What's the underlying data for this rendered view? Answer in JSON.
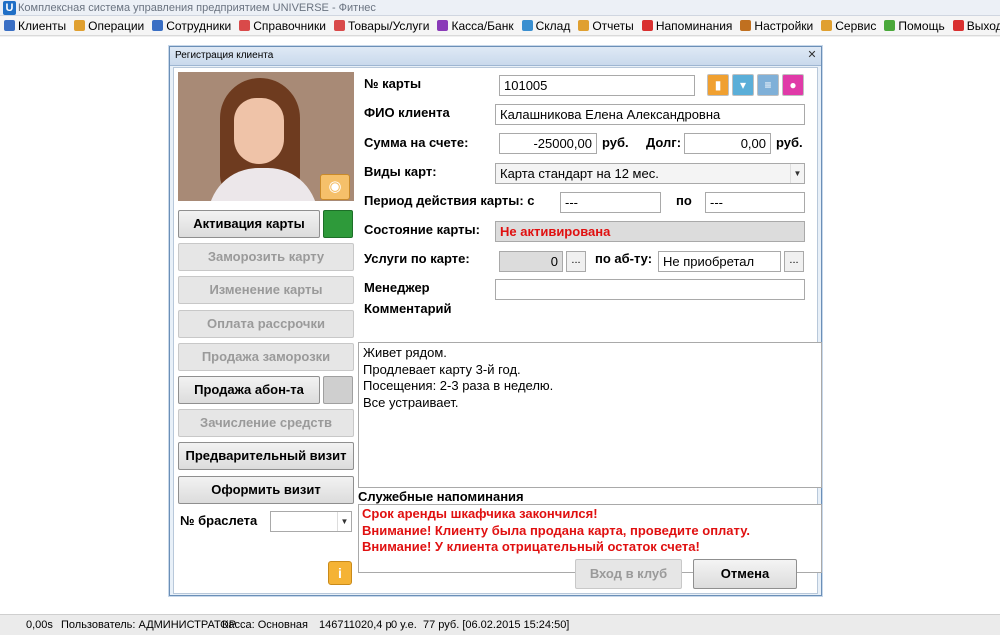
{
  "window": {
    "title": "Комплексная система управления предприятием UNIVERSE - Фитнес",
    "logo_letter": "U"
  },
  "menu": [
    {
      "label": "Клиенты",
      "icon": "clients-icon",
      "color": "#3a6fc4"
    },
    {
      "label": "Операции",
      "icon": "operations-icon",
      "color": "#e0a030"
    },
    {
      "label": "Сотрудники",
      "icon": "employees-icon",
      "color": "#3a6fc4"
    },
    {
      "label": "Справочники",
      "icon": "references-icon",
      "color": "#d94a4a"
    },
    {
      "label": "Товары/Услуги",
      "icon": "goods-icon",
      "color": "#d94a4a"
    },
    {
      "label": "Касса/Банк",
      "icon": "cashbox-icon",
      "color": "#8a3ab8"
    },
    {
      "label": "Склад",
      "icon": "warehouse-icon",
      "color": "#3a8fd0"
    },
    {
      "label": "Отчеты",
      "icon": "reports-icon",
      "color": "#e0a030"
    },
    {
      "label": "Напоминания",
      "icon": "reminders-icon",
      "color": "#d93030"
    },
    {
      "label": "Настройки",
      "icon": "settings-icon",
      "color": "#c07020"
    },
    {
      "label": "Сервис",
      "icon": "service-icon",
      "color": "#e0a030"
    },
    {
      "label": "Помощь",
      "icon": "help-icon",
      "color": "#4aa83a"
    },
    {
      "label": "Выход",
      "icon": "exit-icon",
      "color": "#d93030"
    }
  ],
  "dialog": {
    "title": "Регистрация клиента",
    "left_buttons": {
      "activate": "Активация карты",
      "freeze": "Заморозить карту",
      "change": "Изменение карты",
      "installment": "Оплата рассрочки",
      "sell_freeze": "Продажа заморозки",
      "sell_subscription": "Продажа абон-та",
      "deposit": "Зачисление средств",
      "pre_visit": "Предварительный визит",
      "visit": "Оформить визит"
    },
    "bracelet": {
      "label": "№ браслета",
      "value": ""
    },
    "form": {
      "card_no_label": "№ карты",
      "card_no_value": "101005",
      "fio_label": "ФИО клиента",
      "fio_value": "Калашникова Елена Александровна",
      "balance_label": "Сумма на счете:",
      "balance_value": "-25000,00",
      "currency": "руб.",
      "debt_label": "Долг:",
      "debt_value": "0,00",
      "card_types_label": "Виды карт:",
      "card_type_value": "Карта стандарт на 12 мес.",
      "period_label": "Период действия карты: с",
      "period_from": "---",
      "period_to_label": "по",
      "period_to": "---",
      "status_label": "Состояние карты:",
      "status_value": "Не активирована",
      "services_label": "Услуги по карте:",
      "services_value": "0",
      "dots": "...",
      "per_sub_label": "по аб-ту:",
      "per_sub_value": "Не приобретал",
      "manager_label": "Менеджер",
      "manager_value": "",
      "comment_label": "Комментарий"
    },
    "comment_lines": [
      "Живет рядом.",
      "Продлевает карту 3-й год.",
      "Посещения: 2-3 раза в неделю.",
      "Все устраивает."
    ],
    "reminders_label": "Служебные напоминания",
    "reminders": [
      "Срок аренды шкафчика закончился!",
      "Внимание! Клиенту была продана карта, проведите оплату.",
      "Внимание! У клиента отрицательный остаток счета!"
    ],
    "enter_club": "Вход в клуб",
    "cancel": "Отмена",
    "info_glyph": "i"
  },
  "statusbar": {
    "time": "0,00s",
    "user": "Пользователь: АДМИНИСТРАТОР",
    "cashbox": "Касса: Основная",
    "amount": "146711020,4 р",
    "units": "0 у.е.",
    "last": "77 руб. [06.02.2015 15:24:50]"
  }
}
